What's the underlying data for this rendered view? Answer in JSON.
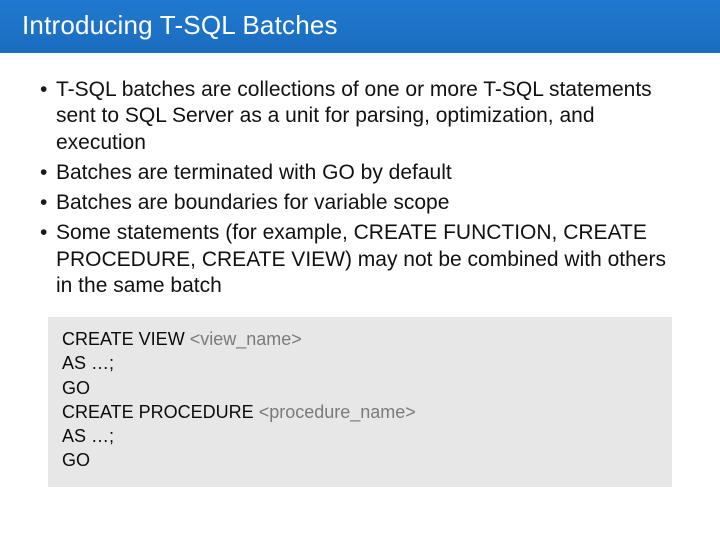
{
  "header": {
    "title": "Introducing T-SQL Batches"
  },
  "body": {
    "bullets": [
      "T-SQL batches are collections of one or more T-SQL statements sent to SQL Server as a unit for parsing, optimization, and execution",
      "Batches are terminated with GO by default",
      "Batches are boundaries for variable scope",
      "Some statements (for example, CREATE FUNCTION, CREATE PROCEDURE, CREATE VIEW) may not be combined with others in the same batch"
    ]
  },
  "code": {
    "l1_kw": "CREATE VIEW ",
    "l1_ph": "<view_name>",
    "l2": "AS …;",
    "l3": "GO",
    "l4_kw": "CREATE PROCEDURE ",
    "l4_ph": "<procedure_name>",
    "l5": "AS …;",
    "l6": "GO"
  }
}
